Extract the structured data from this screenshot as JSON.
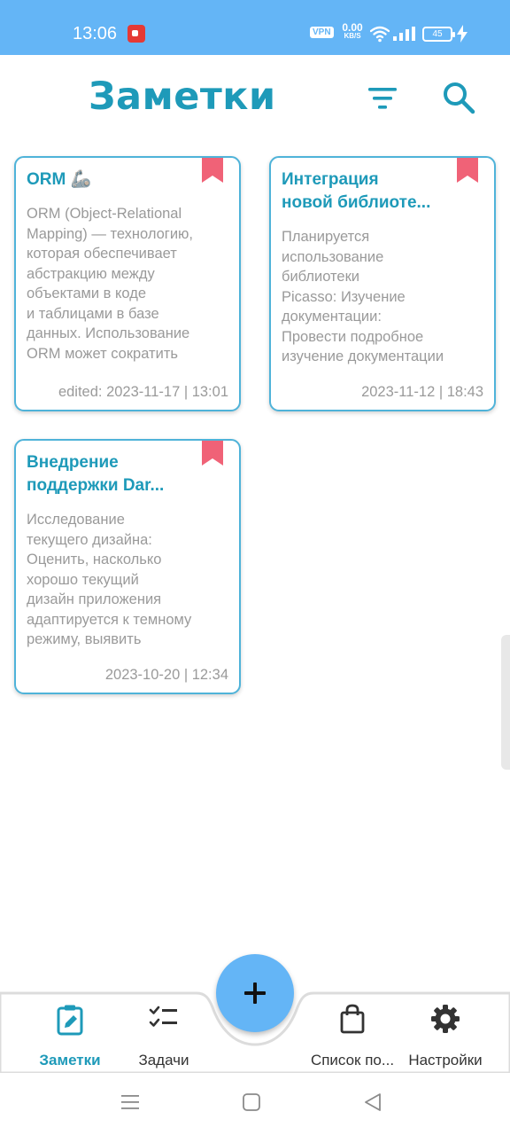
{
  "status_bar": {
    "time": "13:06",
    "vpn": "VPN",
    "net_speed_value": "0.00",
    "net_speed_unit": "KB/S",
    "battery": "45",
    "icons": [
      "screen-record-icon",
      "wifi-icon",
      "signal-icon",
      "battery-icon",
      "charging-bolt-icon"
    ]
  },
  "header": {
    "title": "Заметки",
    "icons": [
      "filter-icon",
      "search-icon"
    ]
  },
  "notes": [
    {
      "title": "ORM 🦾",
      "body": "ORM (Object-Relational\nMapping) — технологию,\nкоторая обеспечивает\nабстракцию между\nобъектами в коде\nи таблицами в базе\nданных. Использование\nORM может сократить",
      "date": "edited: 2023-11-17 | 13:01",
      "bookmarked": true
    },
    {
      "title": "Интеграция\nновой библиоте...",
      "body": "Планируется\nиспользование\nбиблиотеки\nPicasso:  Изучение\nдокументации:\nПровести подробное\nизучение документации",
      "date": "2023-11-12 | 18:43",
      "bookmarked": true
    },
    {
      "title": "Внедрение\nподдержки Dar...",
      "body": "Исследование\nтекущего дизайна:\nОценить, насколько\nхорошо текущий\nдизайн приложения\nадаптируется к темному\nрежиму, выявить",
      "date": "2023-10-20 | 12:34",
      "bookmarked": true
    }
  ],
  "bottom_nav": {
    "items": [
      {
        "label": "Заметки",
        "icon": "note-edit-icon",
        "active": true
      },
      {
        "label": "Задачи",
        "icon": "checklist-icon",
        "active": false
      },
      {
        "label": "Список по...",
        "icon": "shopping-bag-icon",
        "active": false
      },
      {
        "label": "Настройки",
        "icon": "gear-icon",
        "active": false
      }
    ],
    "fab_icon": "plus-icon"
  },
  "colors": {
    "accent": "#1e9ab9",
    "status_bar": "#64b5f6",
    "card_border": "#4fb3d9",
    "bookmark": "#f06277",
    "muted_text": "#9a9a9a"
  }
}
